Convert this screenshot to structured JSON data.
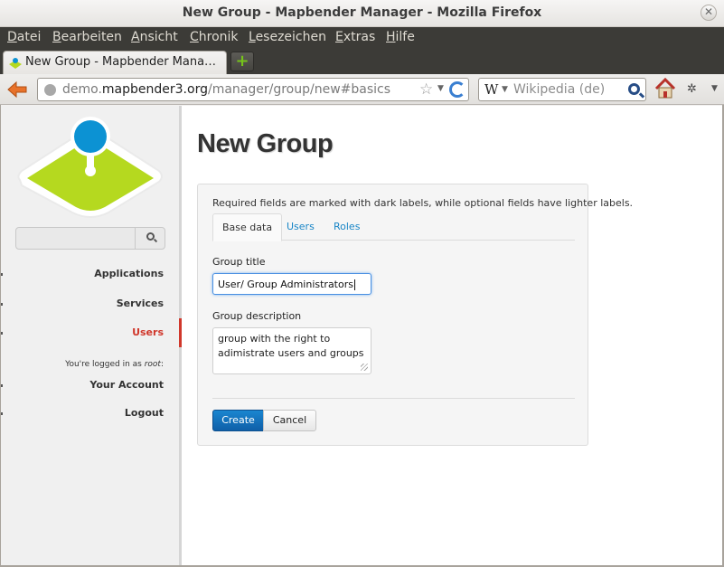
{
  "window": {
    "title": "New Group - Mapbender Manager - Mozilla Firefox"
  },
  "menubar": {
    "items": [
      {
        "first": "D",
        "rest": "atei"
      },
      {
        "first": "B",
        "rest": "earbeiten"
      },
      {
        "first": "A",
        "rest": "nsicht"
      },
      {
        "first": "C",
        "rest": "hronik"
      },
      {
        "first": "L",
        "rest": "esezeichen"
      },
      {
        "first": "E",
        "rest": "xtras"
      },
      {
        "first": "H",
        "rest": "ilfe"
      }
    ]
  },
  "browser": {
    "tab_title": "New Group - Mapbender Mana…",
    "url_prefix": "demo.",
    "url_domain": "mapbender3.org",
    "url_path": "/manager/group/new#basics",
    "search_engine": "W",
    "search_placeholder": "Wikipedia (de)"
  },
  "sidebar": {
    "search_value": "",
    "nav": {
      "applications": "Applications",
      "services": "Services",
      "users": "Users",
      "account": "Your Account",
      "logout": "Logout"
    },
    "logged_in_prefix": "You're logged in as ",
    "logged_in_user": "root",
    "logged_in_suffix": ":"
  },
  "main": {
    "heading": "New Group",
    "hint": "Required fields are marked with dark labels, while optional fields have lighter labels.",
    "tabs": {
      "base": "Base data",
      "users": "Users",
      "roles": "Roles"
    },
    "group_title_label": "Group title",
    "group_title_value": "User/ Group Administrators",
    "group_description_label": "Group description",
    "group_description_value": "group with the right to adimistrate users and groups",
    "create_label": "Create",
    "cancel_label": "Cancel"
  },
  "colors": {
    "accent": "#d0372b",
    "link": "#1a86c7",
    "primary_button": "#0f5fa8",
    "logo_green": "#b5d91f",
    "logo_blue": "#0c92d3"
  }
}
